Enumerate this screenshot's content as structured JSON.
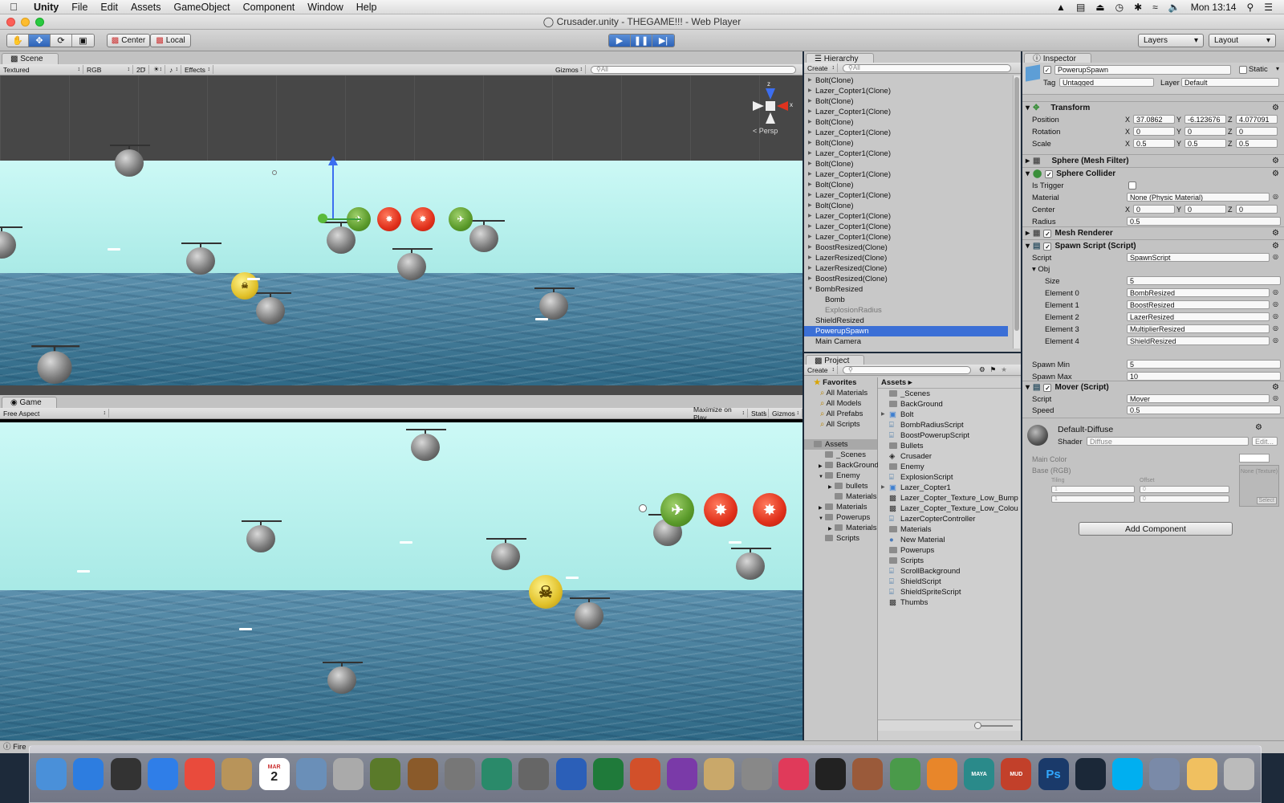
{
  "menubar": {
    "app": "Unity",
    "items": [
      "File",
      "Edit",
      "Assets",
      "GameObject",
      "Component",
      "Window",
      "Help"
    ],
    "clock": "Mon 13:14"
  },
  "window_title": "Crusader.unity - THEGAME!!! - Web Player",
  "toolbar": {
    "center_label": "Center",
    "local_label": "Local",
    "layers_label": "Layers",
    "layout_label": "Layout"
  },
  "scene": {
    "tab": "Scene",
    "shading": "Textured",
    "render_mode": "RGB",
    "mode_2d": "2D",
    "effects": "Effects",
    "gizmos": "Gizmos",
    "search_placeholder": "All",
    "persp": "Persp",
    "axis_z": "z",
    "axis_x": "x"
  },
  "game": {
    "tab": "Game",
    "aspect": "Free Aspect",
    "maximize": "Maximize on Play",
    "stats": "Stats",
    "gizmos": "Gizmos"
  },
  "hierarchy": {
    "tab": "Hierarchy",
    "create": "Create",
    "search_placeholder": "All",
    "items": [
      {
        "label": "Bolt(Clone)",
        "kind": "arrow"
      },
      {
        "label": "Lazer_Copter1(Clone)",
        "kind": "arrow"
      },
      {
        "label": "Bolt(Clone)",
        "kind": "arrow"
      },
      {
        "label": "Lazer_Copter1(Clone)",
        "kind": "arrow"
      },
      {
        "label": "Bolt(Clone)",
        "kind": "arrow"
      },
      {
        "label": "Lazer_Copter1(Clone)",
        "kind": "arrow"
      },
      {
        "label": "Bolt(Clone)",
        "kind": "arrow"
      },
      {
        "label": "Lazer_Copter1(Clone)",
        "kind": "arrow"
      },
      {
        "label": "Bolt(Clone)",
        "kind": "arrow"
      },
      {
        "label": "Lazer_Copter1(Clone)",
        "kind": "arrow"
      },
      {
        "label": "Bolt(Clone)",
        "kind": "arrow"
      },
      {
        "label": "Lazer_Copter1(Clone)",
        "kind": "arrow"
      },
      {
        "label": "Bolt(Clone)",
        "kind": "arrow"
      },
      {
        "label": "Lazer_Copter1(Clone)",
        "kind": "arrow"
      },
      {
        "label": "Lazer_Copter1(Clone)",
        "kind": "arrow"
      },
      {
        "label": "Lazer_Copter1(Clone)",
        "kind": "arrow"
      },
      {
        "label": "BoostResized(Clone)",
        "kind": "arrow"
      },
      {
        "label": "LazerResized(Clone)",
        "kind": "arrow"
      },
      {
        "label": "LazerResized(Clone)",
        "kind": "arrow"
      },
      {
        "label": "BoostResized(Clone)",
        "kind": "arrow"
      },
      {
        "label": "BombResized",
        "kind": "open"
      },
      {
        "label": "Bomb",
        "kind": "child"
      },
      {
        "label": "ExplosionRadius",
        "kind": "child gray"
      },
      {
        "label": "ShieldResized",
        "kind": ""
      },
      {
        "label": "PowerupSpawn",
        "kind": "sel"
      },
      {
        "label": "Main Camera",
        "kind": ""
      }
    ]
  },
  "project": {
    "tab": "Project",
    "create": "Create",
    "favorites_title": "Favorites",
    "favorites": [
      "All Materials",
      "All Models",
      "All Prefabs",
      "All Scripts"
    ],
    "tree_root": "Assets",
    "tree": [
      {
        "label": "_Scenes",
        "indent": 1,
        "arrow": ""
      },
      {
        "label": "BackGround",
        "indent": 1,
        "arrow": "right"
      },
      {
        "label": "Enemy",
        "indent": 1,
        "arrow": "down"
      },
      {
        "label": "bullets",
        "indent": 2,
        "arrow": "right"
      },
      {
        "label": "Materials",
        "indent": 2,
        "arrow": ""
      },
      {
        "label": "Materials",
        "indent": 1,
        "arrow": "right"
      },
      {
        "label": "Powerups",
        "indent": 1,
        "arrow": "down"
      },
      {
        "label": "Materials",
        "indent": 2,
        "arrow": "right"
      },
      {
        "label": "Scripts",
        "indent": 1,
        "arrow": ""
      }
    ],
    "assets_header": "Assets",
    "assets": [
      {
        "label": "_Scenes",
        "icon": "folder-icon"
      },
      {
        "label": "BackGround",
        "icon": "folder-icon"
      },
      {
        "label": "Bolt",
        "icon": "prefab-icon"
      },
      {
        "label": "BombRadiusScript",
        "icon": "script-icon"
      },
      {
        "label": "BoostPowerupScript",
        "icon": "script-icon"
      },
      {
        "label": "Bullets",
        "icon": "folder-icon"
      },
      {
        "label": "Crusader",
        "icon": "unity-scene-icon"
      },
      {
        "label": "Enemy",
        "icon": "folder-icon"
      },
      {
        "label": "ExplosionScript",
        "icon": "script-icon"
      },
      {
        "label": "Lazer_Copter1",
        "icon": "prefab-icon"
      },
      {
        "label": "Lazer_Copter_Texture_Low_Bump",
        "icon": "texture-icon"
      },
      {
        "label": "Lazer_Copter_Texture_Low_Colou",
        "icon": "texture-icon"
      },
      {
        "label": "LazerCopterController",
        "icon": "script-icon"
      },
      {
        "label": "Materials",
        "icon": "folder-icon"
      },
      {
        "label": "New Material",
        "icon": "material-icon"
      },
      {
        "label": "Powerups",
        "icon": "folder-icon"
      },
      {
        "label": "Scripts",
        "icon": "folder-icon"
      },
      {
        "label": "ScrollBackground",
        "icon": "script-icon"
      },
      {
        "label": "ShieldScript",
        "icon": "script-icon"
      },
      {
        "label": "ShieldSpriteScript",
        "icon": "script-icon"
      },
      {
        "label": "Thumbs",
        "icon": "texture-icon"
      }
    ]
  },
  "inspector": {
    "tab": "Inspector",
    "object_name": "PowerupSpawn",
    "static_label": "Static",
    "tag_label": "Tag",
    "tag_value": "Untagged",
    "layer_label": "Layer",
    "layer_value": "Default",
    "transform": {
      "title": "Transform",
      "position_label": "Position",
      "pos_x": "37.0862",
      "pos_y": "-6.123676",
      "pos_z": "4.077091",
      "rotation_label": "Rotation",
      "rot_x": "0",
      "rot_y": "0",
      "rot_z": "0",
      "scale_label": "Scale",
      "scale_x": "0.5",
      "scale_y": "0.5",
      "scale_z": "0.5"
    },
    "mesh_filter_title": "Sphere (Mesh Filter)",
    "collider": {
      "title": "Sphere Collider",
      "is_trigger_label": "Is Trigger",
      "material_label": "Material",
      "material_value": "None (Physic Material)",
      "center_label": "Center",
      "cx": "0",
      "cy": "0",
      "cz": "0",
      "radius_label": "Radius",
      "radius": "0.5"
    },
    "mesh_renderer_title": "Mesh Renderer",
    "spawn": {
      "title": "Spawn Script (Script)",
      "script_label": "Script",
      "script_value": "SpawnScript",
      "obj_label": "Obj",
      "size_label": "Size",
      "size": "5",
      "elements": [
        {
          "label": "Element 0",
          "value": "BombResized"
        },
        {
          "label": "Element 1",
          "value": "BoostResized"
        },
        {
          "label": "Element 2",
          "value": "LazerResized"
        },
        {
          "label": "Element 3",
          "value": "MultiplierResized"
        },
        {
          "label": "Element 4",
          "value": "ShieldResized"
        }
      ],
      "min_label": "Spawn Min",
      "min": "5",
      "max_label": "Spawn Max",
      "max": "10"
    },
    "mover": {
      "title": "Mover (Script)",
      "script_label": "Script",
      "script_value": "Mover",
      "speed_label": "Speed",
      "speed": "0.5"
    },
    "material": {
      "name": "Default-Diffuse",
      "shader_label": "Shader",
      "shader_value": "Diffuse",
      "edit_label": "Edit...",
      "main_color_label": "Main Color",
      "base_label": "Base (RGB)",
      "tiling_label": "Tiling",
      "offset_label": "Offset",
      "tx": "1",
      "ty": "1",
      "ox": "0",
      "oy": "0",
      "texture_none": "None (Texture)",
      "select_label": "Select"
    },
    "add_component": "Add Component"
  },
  "statusbar": {
    "text": "Fire"
  },
  "dock": {
    "apps": [
      "finder-icon",
      "app-store-icon",
      "dashboard-icon",
      "safari-icon",
      "chrome-icon",
      "contacts-icon",
      "calendar-icon",
      "preview-icon",
      "parental-controls-icon",
      "game-icon",
      "garageband-icon",
      "image-capture-icon",
      "time-machine-icon",
      "system-preferences-icon",
      "word-icon",
      "excel-icon",
      "powerpoint-icon",
      "onenote-icon",
      "folder-icon",
      "mail-icon",
      "itunes-icon",
      "unity-icon",
      "blender-icon",
      "map-icon",
      "ibooks-icon",
      "maya-icon",
      "mudbox-icon",
      "photoshop-icon",
      "steam-icon",
      "skype-icon",
      "remote-icon",
      "paint-icon",
      "trash-icon"
    ],
    "calendar_month": "MAR",
    "calendar_day": "2",
    "maya_label": "MAYA",
    "mudbox_label": "MUD",
    "photoshop_label": "Ps"
  }
}
